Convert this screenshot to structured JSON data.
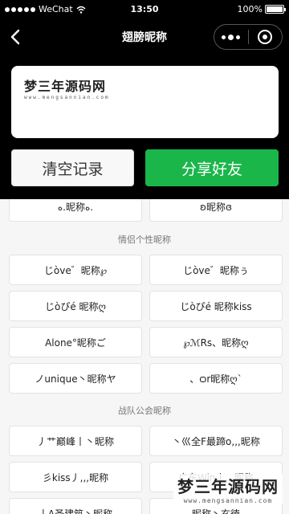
{
  "status_bar": {
    "carrier": "WeChat",
    "time": "13:50",
    "battery": "100%",
    "battery_level": 1.0
  },
  "nav": {
    "title": "翅膀昵称",
    "back_icon": "chevron-left-icon",
    "more_icon": "more-dots-icon",
    "close_icon": "target-circle-icon"
  },
  "input_box": {
    "brand_main": "梦三年源码网",
    "brand_sub": "www.mengsannian.com"
  },
  "buttons": {
    "clear": "清空记录",
    "share": "分享好友"
  },
  "colors": {
    "share_green": "#1ab64a",
    "header_black": "#000000"
  },
  "top_row": [
    "ه.昵称ه.",
    "ʚ昵称ɞ"
  ],
  "sections": [
    {
      "title": "情侣个性昵称",
      "items": [
        "じòve゛昵称℘",
        "じòve゛昵称ぅ",
        "じòぴé 昵称ღ",
        "じòぴé 昵称kiss",
        "Alone°昵称ご",
        "℘ℳRs、昵称ღ",
        "ノunique丶昵称ヤ",
        "、ѻr昵称ღ`"
      ]
    },
    {
      "title": "战队公会昵称",
      "items": [
        "丿艹巅峰丨丶昵称",
        "丶巛全F最蹄o,,,昵称",
        "彡kiss丿,,,昵称",
        "广东Win丨,,,昵称",
        "丨A圣建筑丶昵称",
        "昵称丶玄徳"
      ]
    }
  ],
  "watermark": {
    "main": "梦三年源码网",
    "sub": "www.mengsannian.com"
  }
}
